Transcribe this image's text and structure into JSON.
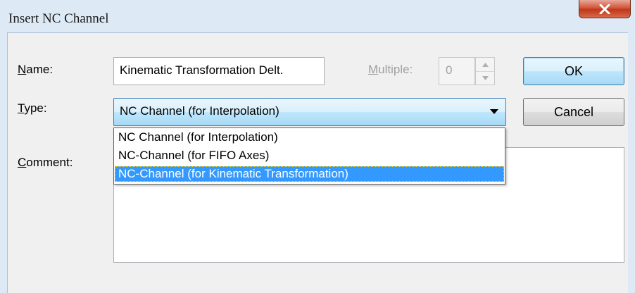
{
  "window": {
    "title": "Insert NC Channel",
    "close_glyph": "X"
  },
  "form": {
    "name_label_mnemonic": "N",
    "name_label_rest": "ame:",
    "name_value": "Kinematic Transformation Delt.",
    "multiple_label_mnemonic": "M",
    "multiple_label_rest": "ultiple:",
    "multiple_value": "0",
    "type_label_mnemonic": "T",
    "type_label_rest": "ype:",
    "type_selected": "NC Channel (for Interpolation)",
    "comment_label_mnemonic": "C",
    "comment_label_rest": "omment:",
    "comment_value": ""
  },
  "buttons": {
    "ok_label": "OK",
    "cancel_label": "Cancel"
  },
  "type_options": [
    "NC Channel (for Interpolation)",
    "NC-Channel (for FIFO Axes)",
    "NC-Channel (for Kinematic Transformation)"
  ],
  "highlighted_option_index": 2,
  "colors": {
    "close_button": "#c03818",
    "selection": "#3399ff",
    "default_button_border": "#3c7fb1"
  }
}
